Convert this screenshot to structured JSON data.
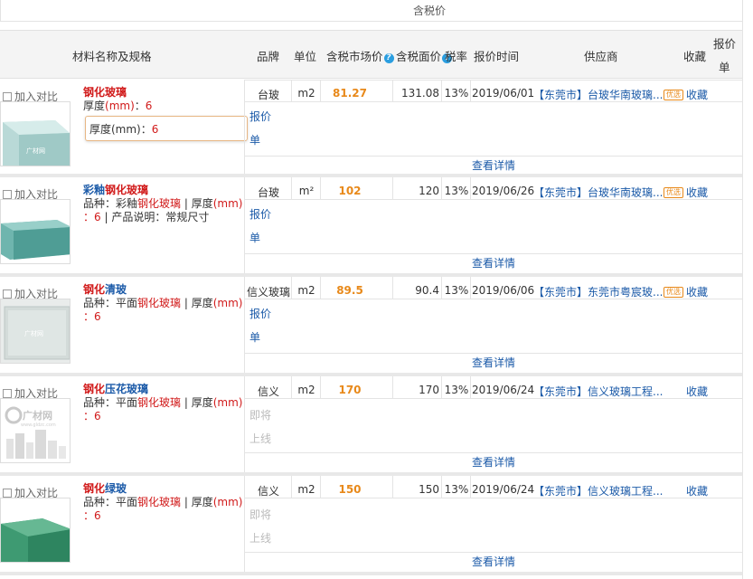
{
  "top_label": "含税价",
  "header": {
    "name_spec": "材料名称及规格",
    "brand": "品牌",
    "unit": "单位",
    "market_price": "含税市场价",
    "tax_price": "含税面价",
    "tax_rate": "税率",
    "quote_time": "报价时间",
    "supplier": "供应商",
    "favorite": "收藏",
    "quote_sheet_1": "报价",
    "quote_sheet_2": "单"
  },
  "common": {
    "compare": "加入对比",
    "detail": "查看详情",
    "quote_1": "报价",
    "quote_2": "单",
    "coming_1": "即将",
    "coming_2": "上线",
    "badge": "优选",
    "favorite": "收藏"
  },
  "tooltip": {
    "label": "厚度(mm)：",
    "value": "6"
  },
  "rows": [
    {
      "name_parts": [
        "钢化玻璃"
      ],
      "spec_line": "厚度(mm)：6",
      "brand": "台玻",
      "unit": "m2",
      "market_price": "81.27",
      "tax_price": "131.08",
      "tax_rate": "13%",
      "date": "2019/06/01",
      "city": "【东莞市】",
      "supplier": "台玻华南玻璃...",
      "preferred": true,
      "can_quote": true
    },
    {
      "name_parts": [
        "彩釉",
        "钢化玻璃"
      ],
      "spec_a": "品种：彩釉",
      "spec_b": "钢化玻璃",
      "spec_c": " | 厚度(mm)",
      "spec_d": "：6 | 产品说明：常规尺寸",
      "brand": "台玻",
      "unit": "m²",
      "market_price": "102",
      "tax_price": "120",
      "tax_rate": "13%",
      "date": "2019/06/26",
      "city": "【东莞市】",
      "supplier": "台玻华南玻璃...",
      "preferred": true,
      "can_quote": true
    },
    {
      "name_parts": [
        "钢化",
        "清玻"
      ],
      "spec_a": "品种：平面",
      "spec_b": "钢化玻璃",
      "spec_c": " | 厚度(mm)",
      "spec_d": "：6",
      "brand": "信义玻璃",
      "unit": "m2",
      "market_price": "89.5",
      "tax_price": "90.4",
      "tax_rate": "13%",
      "date": "2019/06/06",
      "city": "【东莞市】",
      "supplier": "东莞市粤宸玻...",
      "preferred": true,
      "can_quote": true
    },
    {
      "name_parts": [
        "钢化",
        "压花玻璃"
      ],
      "spec_a": "品种：平面",
      "spec_b": "钢化玻璃",
      "spec_c": " | 厚度(mm)",
      "spec_d": "：6",
      "brand": "信义",
      "unit": "m2",
      "market_price": "170",
      "tax_price": "170",
      "tax_rate": "13%",
      "date": "2019/06/24",
      "city": "【东莞市】",
      "supplier": "信义玻璃工程...",
      "preferred": false,
      "can_quote": false
    },
    {
      "name_parts": [
        "钢化",
        "绿玻"
      ],
      "spec_a": "品种：平面",
      "spec_b": "钢化玻璃",
      "spec_c": " | 厚度(mm)",
      "spec_d": "：6",
      "brand": "信义",
      "unit": "m2",
      "market_price": "150",
      "tax_price": "150",
      "tax_rate": "13%",
      "date": "2019/06/24",
      "city": "【东莞市】",
      "supplier": "信义玻璃工程...",
      "preferred": false,
      "can_quote": false
    }
  ],
  "thumb_watermark_1": "广材网",
  "thumb_watermark_2": "广材网",
  "thumb_watermark_sub": "www.gldzc.com",
  "colors": {
    "link": "#1b5aa8",
    "price": "#e8891a",
    "highlight": "#d11a1a"
  }
}
